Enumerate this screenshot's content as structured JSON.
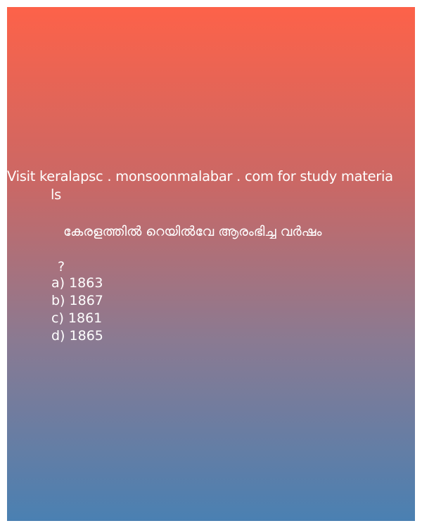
{
  "site_note": {
    "line1": "Visit keralapsc . monsoonmalabar . com for study materia",
    "line2": "ls"
  },
  "question": {
    "text": "കേരളത്തിൽ റെയിൽവേ ആരംഭിച്ച വർഷം",
    "mark": "?"
  },
  "options": [
    "a) 1863",
    "b) 1867",
    "c) 1861",
    "d) 1865"
  ],
  "colors": {
    "gradient_top": "#fd6249",
    "gradient_bottom": "#4a80b2",
    "text": "#ffffff"
  }
}
